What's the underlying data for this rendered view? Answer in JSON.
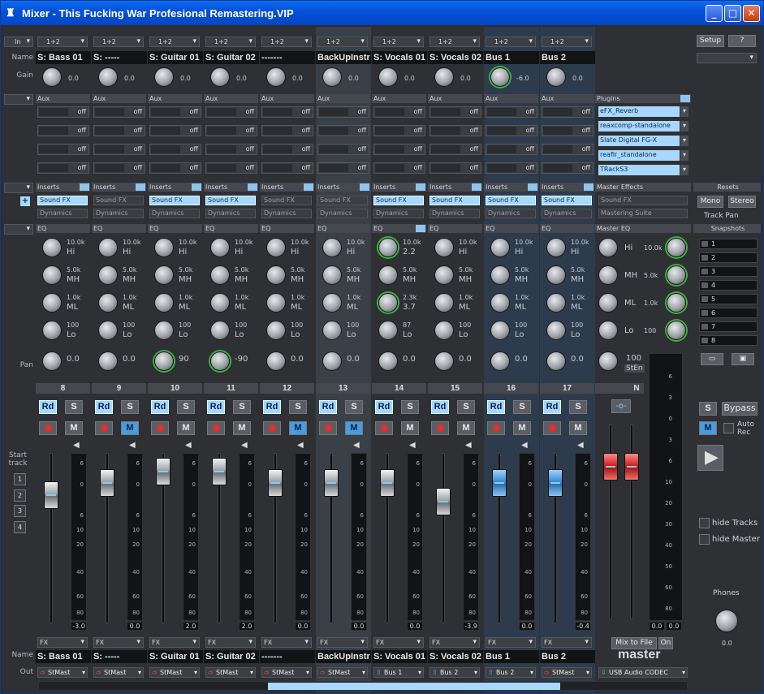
{
  "window": {
    "title": "Mixer - This Fucking War Profesional Remastering.VIP"
  },
  "rows": {
    "in": "In",
    "name": "Name",
    "gain": "Gain",
    "aux": "Aux",
    "inserts": "Inserts",
    "eq": "EQ",
    "pan": "Pan",
    "start_track": "Start track",
    "name2": "Name",
    "out": "Out"
  },
  "eq_band_labels": [
    "Hi",
    "MH",
    "ML",
    "Lo"
  ],
  "channels": [
    {
      "num": "8",
      "input": "1+2",
      "name": "S: Bass 01",
      "gain": "0.0",
      "fx1": "Sound FX",
      "fx2": "Dynamics",
      "fx1_on": true,
      "eq": [
        [
          "10.0k",
          "Hi"
        ],
        [
          "5.0k",
          "MH"
        ],
        [
          "1.0k",
          "ML"
        ],
        [
          "100",
          "Lo"
        ]
      ],
      "pan": "0.0",
      "level": "-3.0",
      "m_on": false,
      "fx_label": "FX",
      "out": "StMast",
      "out_arrow": "red"
    },
    {
      "num": "9",
      "input": "1+2",
      "name": "S: -----",
      "gain": "0.0",
      "fx1": "Sound FX",
      "fx2": "Dynamics",
      "fx1_on": false,
      "eq": [
        [
          "10.0k",
          "Hi"
        ],
        [
          "5.0k",
          "MH"
        ],
        [
          "1.0k",
          "ML"
        ],
        [
          "100",
          "Lo"
        ]
      ],
      "pan": "0.0",
      "level": "0.0",
      "m_on": true,
      "fx_label": "FX",
      "out": "StMast",
      "out_arrow": "red"
    },
    {
      "num": "10",
      "input": "1+2",
      "name": "S: Guitar 01",
      "gain": "0.0",
      "fx1": "Sound FX",
      "fx2": "Dynamics",
      "fx1_on": true,
      "eq": [
        [
          "10.0k",
          "Hi"
        ],
        [
          "5.0k",
          "MH"
        ],
        [
          "1.0k",
          "ML"
        ],
        [
          "100",
          "Lo"
        ]
      ],
      "pan": "90",
      "level": "2.0",
      "m_on": false,
      "fx_label": "FX",
      "out": "StMast",
      "out_arrow": "red"
    },
    {
      "num": "11",
      "input": "1+2",
      "name": "S: Guitar 02",
      "gain": "0.0",
      "fx1": "Sound FX",
      "fx2": "Dynamics",
      "fx1_on": true,
      "eq": [
        [
          "10.0k",
          "Hi"
        ],
        [
          "5.0k",
          "MH"
        ],
        [
          "1.0k",
          "ML"
        ],
        [
          "100",
          "Lo"
        ]
      ],
      "pan": "-90",
      "level": "2.0",
      "m_on": false,
      "fx_label": "FX",
      "out": "StMast",
      "out_arrow": "red"
    },
    {
      "num": "12",
      "input": "1+2",
      "name": "-------",
      "gain": "0.0",
      "fx1": "Sound FX",
      "fx2": "Dynamics",
      "fx1_on": false,
      "eq": [
        [
          "10.0k",
          "Hi"
        ],
        [
          "5.0k",
          "MH"
        ],
        [
          "1.0k",
          "ML"
        ],
        [
          "100",
          "Lo"
        ]
      ],
      "pan": "0.0",
      "level": "0.0",
      "m_on": true,
      "fx_label": "FX",
      "out": "StMast",
      "out_arrow": "red"
    },
    {
      "num": "13",
      "input": "1+2",
      "name": "BackUpInstr",
      "gain": "0.0",
      "fx1": "Sound FX",
      "fx2": "Dynamics",
      "fx1_on": false,
      "eq": [
        [
          "10.0k",
          "Hi"
        ],
        [
          "5.0k",
          "MH"
        ],
        [
          "1.0k",
          "ML"
        ],
        [
          "100",
          "Lo"
        ]
      ],
      "pan": "0.0",
      "level": "0.0",
      "m_on": true,
      "fx_label": "FX",
      "out": "StMast",
      "out_arrow": "red"
    },
    {
      "num": "14",
      "input": "1+2",
      "name": "S: Vocals 01",
      "gain": "0.0",
      "fx1": "Sound FX",
      "fx2": "Dynamics",
      "fx1_on": true,
      "eq": [
        [
          "10.0k",
          "2.2"
        ],
        [
          "5.0k",
          "MH"
        ],
        [
          "2.3k",
          "3.7"
        ],
        [
          "87",
          "Lo"
        ]
      ],
      "pan": "0.0",
      "level": "0.0",
      "m_on": false,
      "fx_label": "FX",
      "out": "Bus 1",
      "out_arrow": "blue"
    },
    {
      "num": "15",
      "input": "1+2",
      "name": "S: Vocals 02",
      "gain": "0.0",
      "fx1": "Sound FX",
      "fx2": "Dynamics",
      "fx1_on": true,
      "eq": [
        [
          "10.0k",
          "Hi"
        ],
        [
          "5.0k",
          "MH"
        ],
        [
          "1.0k",
          "ML"
        ],
        [
          "100",
          "Lo"
        ]
      ],
      "pan": "0.0",
      "level": "-3.9",
      "m_on": false,
      "fx_label": "FX",
      "out": "Bus 2",
      "out_arrow": "blue"
    },
    {
      "num": "16",
      "input": "1+2",
      "name": "Bus  1",
      "gain": "-6.0",
      "fx1": "Sound FX",
      "fx2": "Dynamics",
      "fx1_on": true,
      "eq": [
        [
          "10.0k",
          "Hi"
        ],
        [
          "5.0k",
          "MH"
        ],
        [
          "1.0k",
          "ML"
        ],
        [
          "100",
          "Lo"
        ]
      ],
      "pan": "0.0",
      "level": "0.0",
      "m_on": false,
      "fx_label": "FX",
      "out": "Bus 2",
      "out_arrow": "blue"
    },
    {
      "num": "17",
      "input": "1+2",
      "name": "Bus  2",
      "gain": "0.0",
      "fx1": "Sound FX",
      "fx2": "Dynamics",
      "fx1_on": true,
      "eq": [
        [
          "10.0k",
          "Hi"
        ],
        [
          "5.0k",
          "MH"
        ],
        [
          "1.0k",
          "ML"
        ],
        [
          "100",
          "Lo"
        ]
      ],
      "pan": "0.0",
      "level": "-0.4",
      "m_on": false,
      "fx_label": "FX",
      "out": "StMast",
      "out_arrow": "red"
    }
  ],
  "aux_off": "off",
  "buttons": {
    "rd": "Rd",
    "s": "S",
    "m": "M"
  },
  "meter_ticks": [
    "6",
    "0",
    "6",
    "10",
    "20",
    "40",
    "60",
    "80"
  ],
  "master": {
    "plugins_header": "Plugins",
    "plugins": [
      "eFX_Reverb",
      "reaxcomp-standalone",
      "Slate Digital FG-X",
      "reafir_standalone",
      "TRackS3"
    ],
    "effects_header": "Master Effects",
    "effects": [
      "Sound FX",
      "Mastering Suite"
    ],
    "eq_header": "Master EQ",
    "eq": [
      [
        "Hi",
        "10.0k"
      ],
      [
        "MH",
        "5.0k"
      ],
      [
        "ML",
        "1.0k"
      ],
      [
        "Lo",
        "100"
      ]
    ],
    "pan_value": "100",
    "pan_mode": "StEn",
    "n_label": "N",
    "mix_to_file": "Mix to File",
    "on_label": "On",
    "title": "master",
    "out": "USB Audio CODEC",
    "meter_ticks": [
      "6",
      "3",
      "0",
      "3",
      "6",
      "10",
      "20",
      "30",
      "40",
      "50",
      "60",
      "80"
    ],
    "meter_vals": [
      "0.0",
      "0.0"
    ]
  },
  "right": {
    "setup": "Setup",
    "help": "?",
    "resets": "Resets",
    "mono": "Mono",
    "stereo": "Stereo",
    "track_pan": "Track Pan",
    "snapshots": "Snapshots",
    "snapshot_items": [
      "1",
      "2",
      "3",
      "4",
      "5",
      "6",
      "7",
      "8"
    ],
    "s": "S",
    "bypass": "Bypass",
    "m": "M",
    "auto_rec": "Auto Rec",
    "hide_tracks": "hide Tracks",
    "hide_master": "hide Master",
    "phones": "Phones",
    "phones_val": "0.0"
  },
  "start_tracks": [
    "1",
    "2",
    "3",
    "4"
  ]
}
